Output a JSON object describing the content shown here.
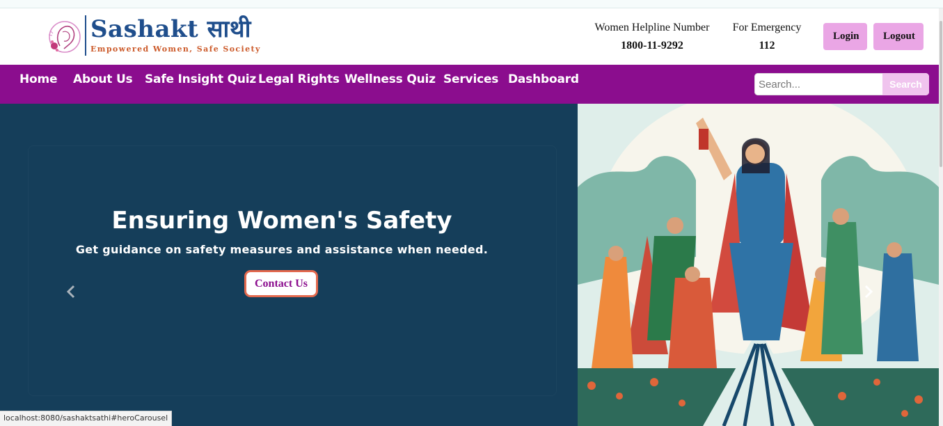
{
  "brand": {
    "name": "Sashakt साथी",
    "tagline": "Empowered Women, Safe Society"
  },
  "helpline": {
    "women_label": "Women Helpline Number",
    "women_number": "1800-11-9292",
    "emergency_label": "For Emergency",
    "emergency_number": "112"
  },
  "auth": {
    "login_label": "Login",
    "logout_label": "Logout"
  },
  "nav": {
    "items": [
      "Home",
      "About Us",
      "Safe Insight Quiz",
      "Legal Rights",
      "Wellness Quiz",
      "Services",
      "Dashboard"
    ]
  },
  "search": {
    "placeholder": "Search...",
    "button_label": "Search"
  },
  "hero": {
    "title": "Ensuring Women's Safety",
    "subtitle": "Get guidance on safety measures and assistance when needed.",
    "cta_label": "Contact Us"
  },
  "statusbar": {
    "url": "localhost:8080/sashaktsathi#heroCarousel"
  },
  "colors": {
    "nav_bg": "#8b0d8e",
    "hero_bg": "#153e5a",
    "button_pink": "#eaa6e5",
    "brand_blue": "#1f4e8c",
    "tagline_orange": "#cc5a2a"
  }
}
